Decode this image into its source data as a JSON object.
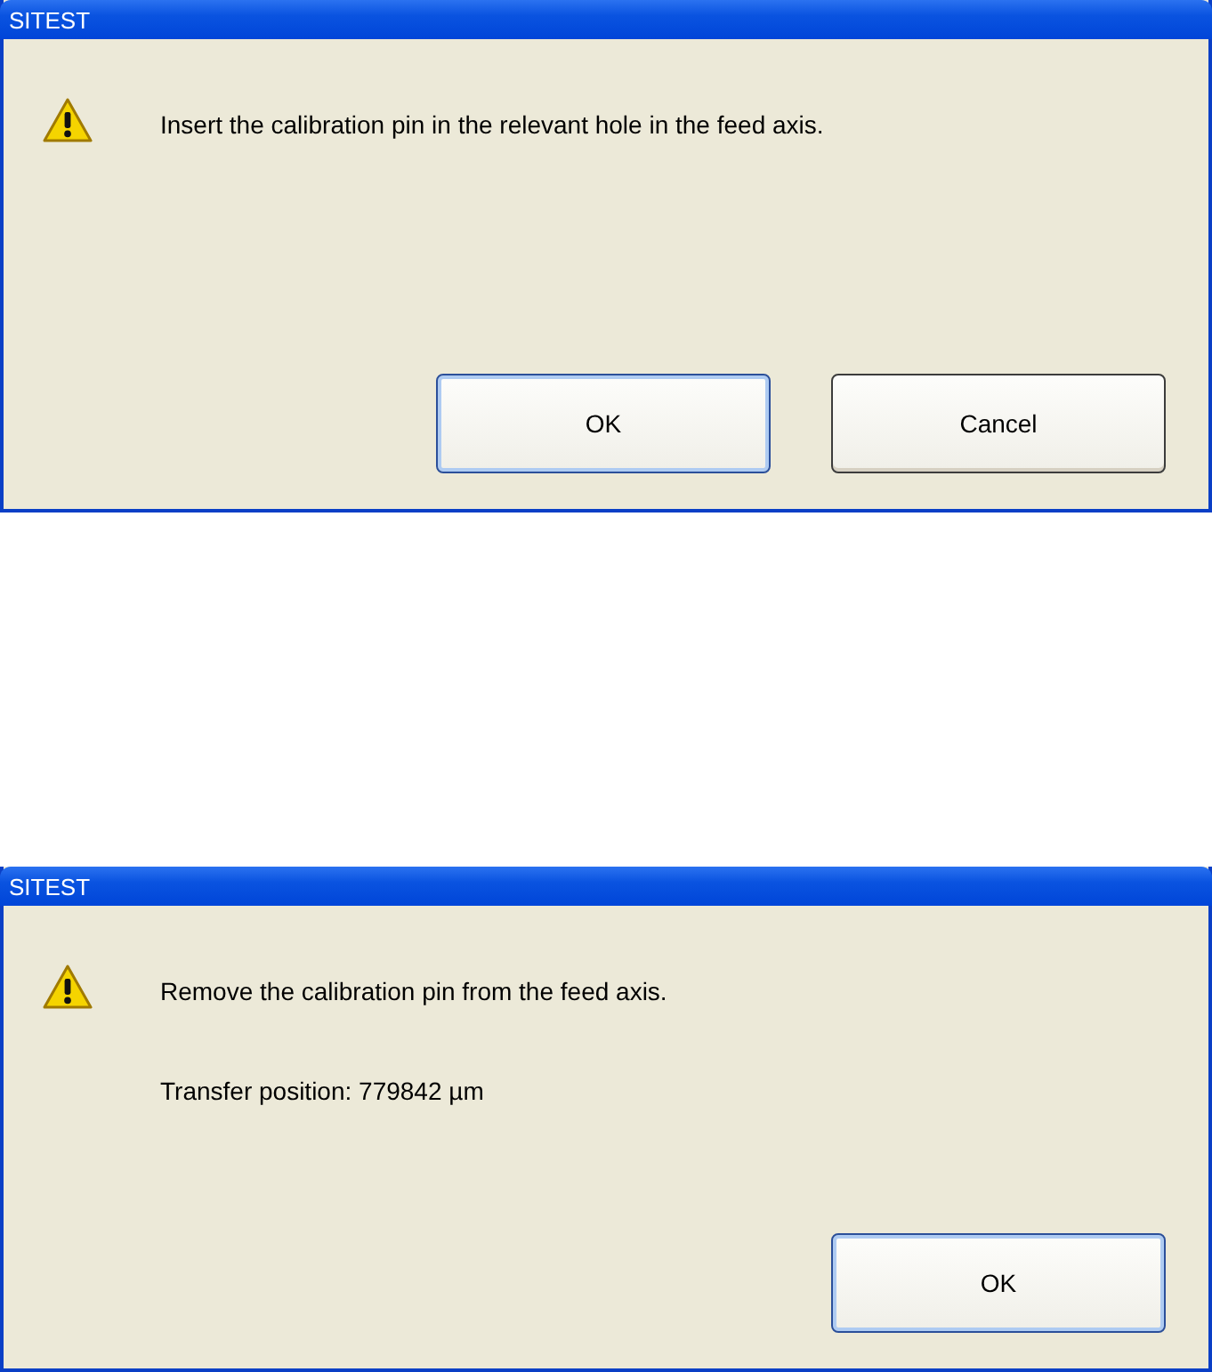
{
  "dialogs": [
    {
      "title": "SITEST",
      "kind": "warning",
      "messages": [
        "Insert the calibration pin in the relevant hole in the feed axis."
      ],
      "buttons": [
        {
          "label": "OK",
          "default": true
        },
        {
          "label": "Cancel",
          "default": false
        }
      ]
    },
    {
      "title": "SITEST",
      "kind": "warning",
      "messages": [
        "Remove the calibration pin from the feed axis.",
        "Transfer position: 779842 µm"
      ],
      "buttons": [
        {
          "label": "OK",
          "default": true
        }
      ]
    }
  ]
}
